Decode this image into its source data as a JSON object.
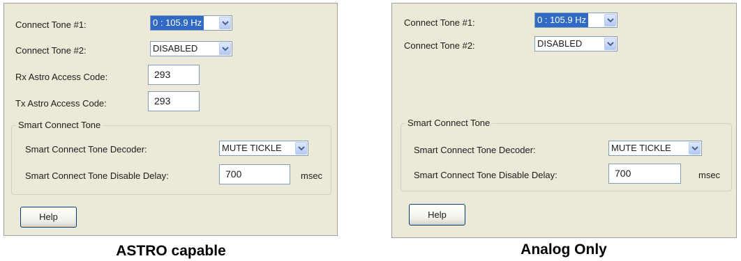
{
  "panels": [
    {
      "connect_tone_1": {
        "label": "Connect Tone #1:",
        "value": "0 : 105.9 Hz"
      },
      "connect_tone_2": {
        "label": "Connect Tone #2:",
        "value": "DISABLED"
      },
      "rx_astro": {
        "label": "Rx Astro Access Code:",
        "value": "293"
      },
      "tx_astro": {
        "label": "Tx Astro Access Code:",
        "value": "293"
      },
      "smart_group": {
        "title": "Smart Connect Tone",
        "decoder": {
          "label": "Smart Connect Tone Decoder:",
          "value": "MUTE TICKLE"
        },
        "disable_delay": {
          "label": "Smart Connect Tone Disable Delay:",
          "value": "700",
          "unit": "msec"
        }
      },
      "help_label": "Help",
      "caption": "ASTRO capable"
    },
    {
      "connect_tone_1": {
        "label": "Connect Tone #1:",
        "value": "0 : 105.9 Hz"
      },
      "connect_tone_2": {
        "label": "Connect Tone #2:",
        "value": "DISABLED"
      },
      "smart_group": {
        "title": "Smart Connect Tone",
        "decoder": {
          "label": "Smart Connect Tone Decoder:",
          "value": "MUTE TICKLE"
        },
        "disable_delay": {
          "label": "Smart Connect Tone Disable Delay:",
          "value": "700",
          "unit": "msec"
        }
      },
      "help_label": "Help",
      "caption": "Analog Only"
    }
  ],
  "colors": {
    "panel_bg": "#ece9d8",
    "selection": "#316ac5",
    "field_border": "#7f9db9",
    "dropdown_arrow": "#4d6185"
  },
  "icons": {
    "dropdown": "chevron-down-icon"
  }
}
